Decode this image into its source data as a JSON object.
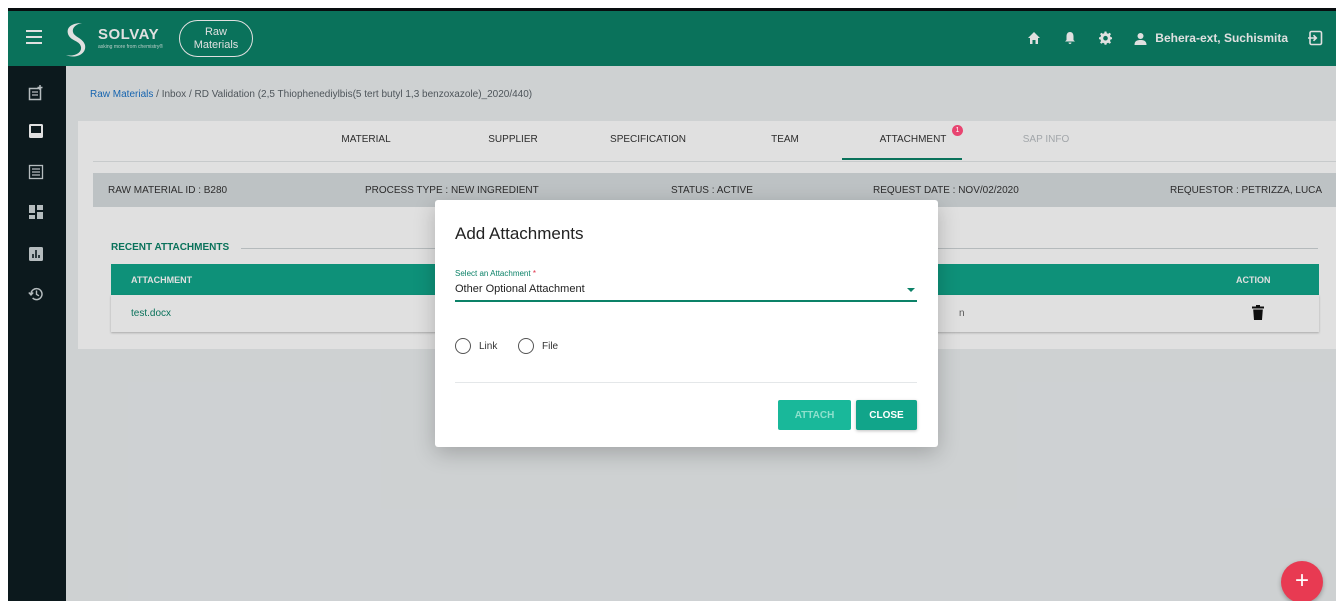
{
  "app": {
    "brand": "SOLVAY",
    "brand_tagline": "asking more from chemistry®",
    "badge_line1": "Raw",
    "badge_line2": "Materials",
    "user_name": "Behera-ext, Suchismita"
  },
  "breadcrumb": {
    "root": "Raw Materials",
    "sep1": "/",
    "inbox": "Inbox",
    "sep2": "/",
    "current": "RD Validation (2,5 Thiophenediylbis(5 tert butyl 1,3 benzoxazole)_2020/440)"
  },
  "tabs": [
    {
      "label": "MATERIAL"
    },
    {
      "label": "SUPPLIER"
    },
    {
      "label": "SPECIFICATION"
    },
    {
      "label": "TEAM"
    },
    {
      "label": "ATTACHMENT",
      "badge": "1",
      "active": true
    },
    {
      "label": "SAP INFO",
      "disabled": true
    }
  ],
  "infobar": {
    "raw_material_id": "RAW MATERIAL ID : B280",
    "process_type": "PROCESS TYPE : NEW INGREDIENT",
    "status": "STATUS : ACTIVE",
    "request_date": "REQUEST DATE : NOV/02/2020",
    "requestor": "REQUESTOR : PETRIZZA, LUCA"
  },
  "attachments": {
    "section_title": "RECENT ATTACHMENTS",
    "col_attachment": "ATTACHMENT",
    "col_action": "ACTION",
    "rows": [
      {
        "name": "test.docx",
        "trail": "n"
      }
    ]
  },
  "modal": {
    "title": "Add Attachments",
    "select_label": "Select an Attachment",
    "required_mark": "*",
    "select_value": "Other Optional Attachment",
    "radio_link": "Link",
    "radio_file": "File",
    "attach_label": "ATTACH",
    "close_label": "CLOSE"
  },
  "fab": {
    "label": "+"
  },
  "colors": {
    "primary": "#0c8268",
    "accent": "#11a58a",
    "sidebar": "#0e1d22",
    "fab": "#e83a52",
    "badge": "#e84470"
  }
}
